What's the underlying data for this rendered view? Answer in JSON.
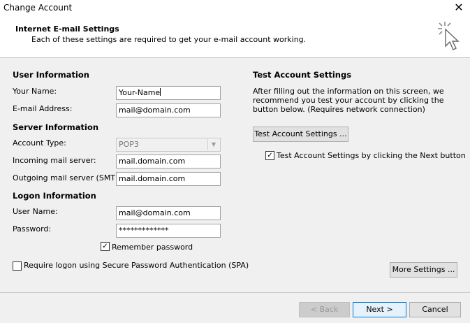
{
  "window": {
    "title": "Change Account"
  },
  "header": {
    "title": "Internet E-mail Settings",
    "subtitle": "Each of these settings are required to get your e-mail account working."
  },
  "user_info": {
    "heading": "User Information",
    "name_label": "Your Name:",
    "name_value": "Your-Name",
    "email_label": "E-mail Address:",
    "email_value": "mail@domain.com"
  },
  "server_info": {
    "heading": "Server Information",
    "account_type_label": "Account Type:",
    "account_type_value": "POP3",
    "incoming_label": "Incoming mail server:",
    "incoming_value": "mail.domain.com",
    "outgoing_label": "Outgoing mail server (SMTP):",
    "outgoing_value": "mail.domain.com"
  },
  "logon_info": {
    "heading": "Logon Information",
    "username_label": "User Name:",
    "username_value": "mail@domain.com",
    "password_label": "Password:",
    "password_value": "*************",
    "remember_label": "Remember password",
    "remember_checked": true,
    "spa_label": "Require logon using Secure Password Authentication (SPA)",
    "spa_checked": false
  },
  "test_settings": {
    "heading": "Test Account Settings",
    "description": "After filling out the information on this screen, we recommend you test your account by clicking the button below. (Requires network connection)",
    "test_button": "Test Account Settings ...",
    "next_check_label": "Test Account Settings by clicking the Next button",
    "next_check_checked": true
  },
  "buttons": {
    "more_settings": "More Settings ...",
    "back": "< Back",
    "next": "Next >",
    "cancel": "Cancel"
  },
  "icons": {
    "close": "close-icon",
    "cursor": "cursor-click-icon",
    "checkmark": "✓",
    "dropdown": "chevron-down-icon"
  }
}
